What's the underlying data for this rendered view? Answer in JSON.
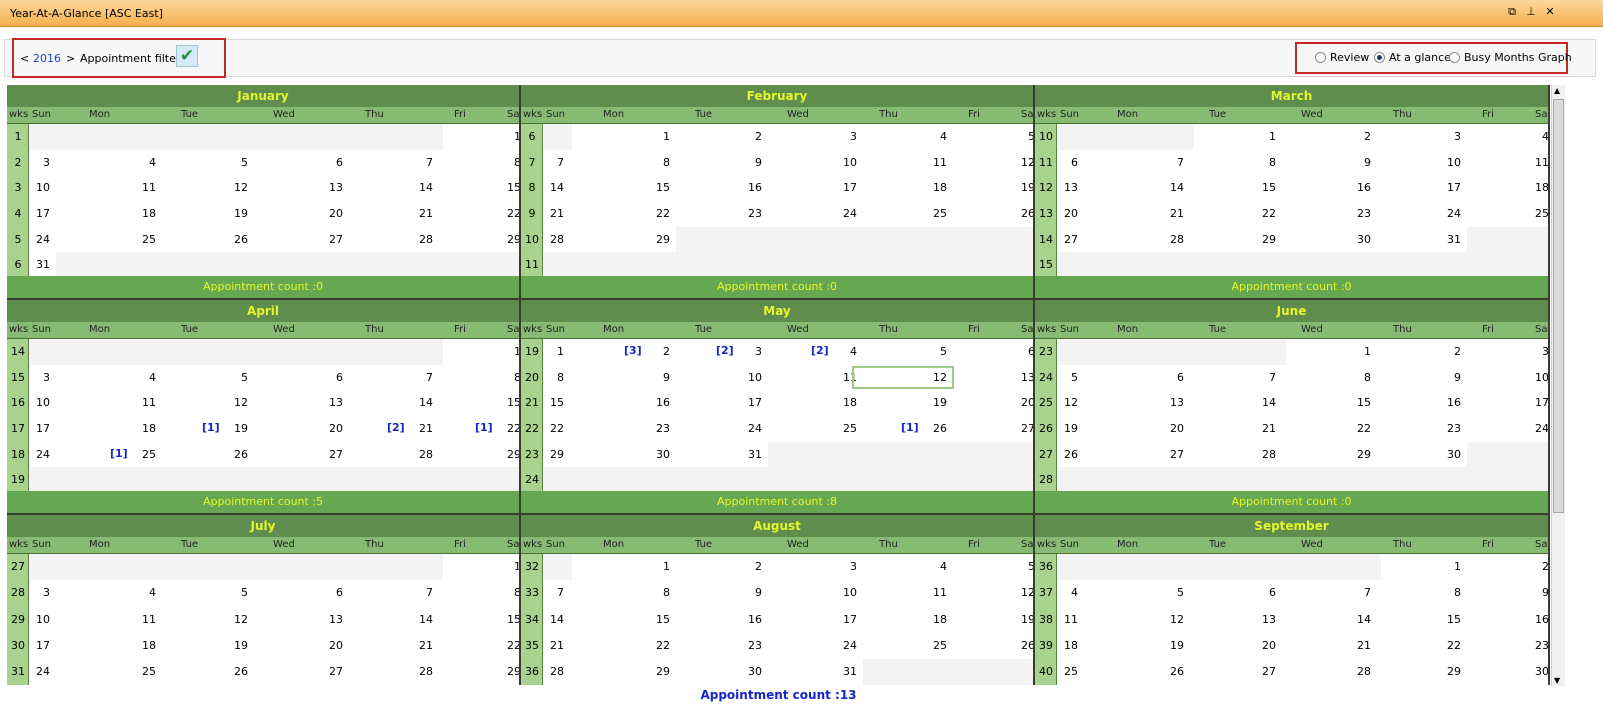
{
  "window": {
    "title": "Year-At-A-Glance  [ASC East]",
    "btn_restore": "⧉",
    "btn_pin": "⊥",
    "btn_close": "✕"
  },
  "toolbar": {
    "prev": "<",
    "year": "2016",
    "next": ">",
    "filter_label": "Appointment filters",
    "filter_check": "✔",
    "views": [
      "Review",
      "At a glance",
      "Busy Months Graph"
    ],
    "selected_view": "At a glance"
  },
  "dow": [
    "Sun",
    "Mon",
    "Tue",
    "Wed",
    "Thu",
    "Fri",
    "Sat"
  ],
  "wks_label": "wks",
  "months": [
    {
      "name": "January",
      "count": "Appointment count :0",
      "weeks": [
        1,
        2,
        3,
        4,
        5,
        6
      ],
      "first_dow": 5,
      "days": 31,
      "badges": {}
    },
    {
      "name": "February",
      "count": "Appointment count :0",
      "weeks": [
        6,
        7,
        8,
        9,
        10,
        11
      ],
      "first_dow": 1,
      "days": 29,
      "badges": {}
    },
    {
      "name": "March",
      "count": "Appointment count :0",
      "weeks": [
        10,
        11,
        12,
        13,
        14,
        15
      ],
      "first_dow": 2,
      "days": 31,
      "badges": {}
    },
    {
      "name": "April",
      "count": "Appointment count :5",
      "weeks": [
        14,
        15,
        16,
        17,
        18,
        19
      ],
      "first_dow": 5,
      "days": 30,
      "badges": {
        "19": "[1]",
        "21": "[2]",
        "22": "[1]",
        "25": "[1]"
      }
    },
    {
      "name": "May",
      "count": "Appointment count :8",
      "weeks": [
        19,
        20,
        21,
        22,
        23,
        24
      ],
      "first_dow": 0,
      "days": 31,
      "badges": {
        "2": "[3]",
        "3": "[2]",
        "4": "[2]",
        "26": "[1]"
      }
    },
    {
      "name": "June",
      "count": "Appointment count :0",
      "weeks": [
        23,
        24,
        25,
        26,
        27,
        28
      ],
      "first_dow": 3,
      "days": 30,
      "badges": {}
    },
    {
      "name": "July",
      "count": "",
      "weeks": [
        27,
        28,
        29,
        30,
        31
      ],
      "first_dow": 5,
      "days": 30,
      "badges": {}
    },
    {
      "name": "August",
      "count": "",
      "weeks": [
        32,
        33,
        34,
        35,
        36
      ],
      "first_dow": 1,
      "days": 31,
      "badges": {}
    },
    {
      "name": "September",
      "count": "",
      "weeks": [
        36,
        37,
        38,
        39,
        40
      ],
      "first_dow": 4,
      "days": 30,
      "badges": {}
    }
  ],
  "today": {
    "month": "May",
    "day": "12"
  },
  "status": "Appointment count :13",
  "colors": {
    "header": "#5f8d4d",
    "dow": "#87bb73",
    "count_bar": "#66a851",
    "yellow": "#e7f52b",
    "badge": "#1526c8"
  }
}
